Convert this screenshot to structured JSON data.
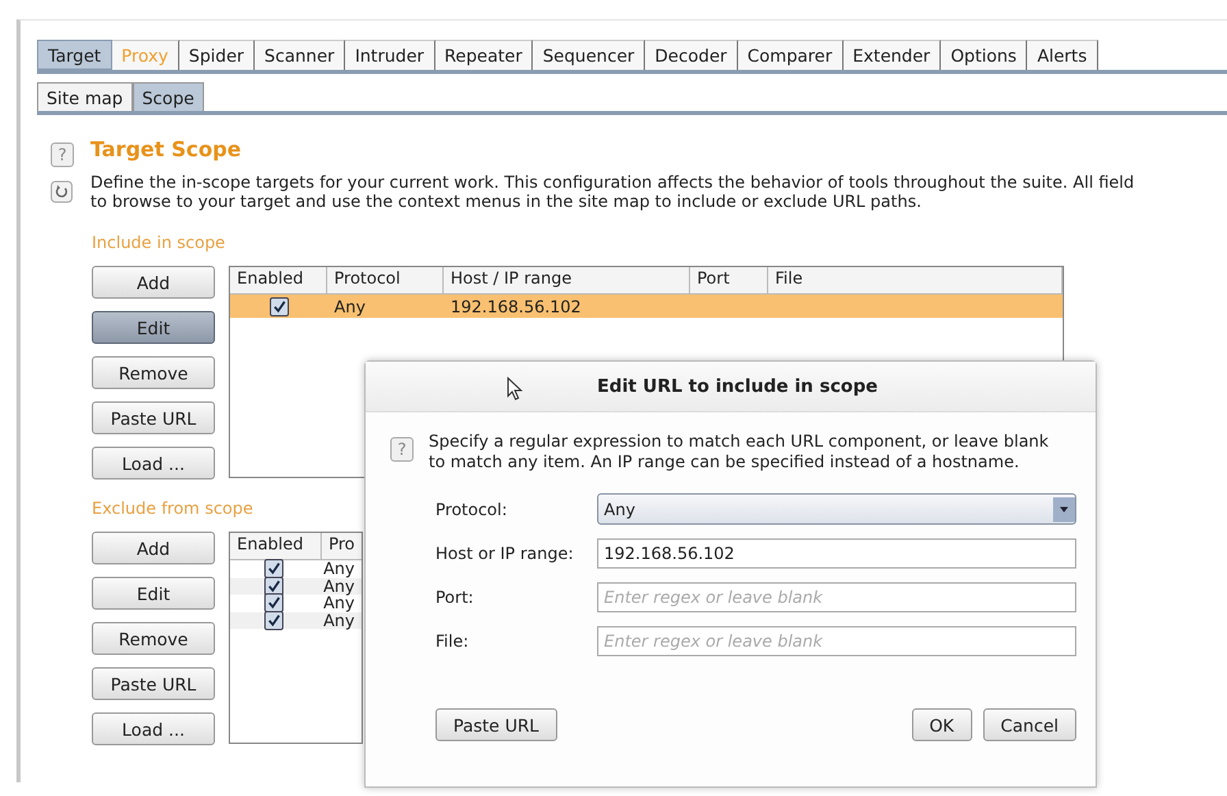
{
  "tabs": [
    {
      "label": "Target",
      "selected": true,
      "attention": false
    },
    {
      "label": "Proxy",
      "selected": false,
      "attention": true
    },
    {
      "label": "Spider",
      "selected": false,
      "attention": false
    },
    {
      "label": "Scanner",
      "selected": false,
      "attention": false
    },
    {
      "label": "Intruder",
      "selected": false,
      "attention": false
    },
    {
      "label": "Repeater",
      "selected": false,
      "attention": false
    },
    {
      "label": "Sequencer",
      "selected": false,
      "attention": false
    },
    {
      "label": "Decoder",
      "selected": false,
      "attention": false
    },
    {
      "label": "Comparer",
      "selected": false,
      "attention": false
    },
    {
      "label": "Extender",
      "selected": false,
      "attention": false
    },
    {
      "label": "Options",
      "selected": false,
      "attention": false
    },
    {
      "label": "Alerts",
      "selected": false,
      "attention": false
    }
  ],
  "subtabs": [
    {
      "label": "Site map",
      "selected": false
    },
    {
      "label": "Scope",
      "selected": true
    }
  ],
  "help_icon": "?",
  "title": "Target Scope",
  "description": "Define the in-scope targets for your current work. This configuration affects the behavior of tools throughout the suite. All field\nto browse to your target and use the context menus in the site map to include or exclude URL paths.",
  "include": {
    "label": "Include in scope",
    "buttons": [
      {
        "label": "Add",
        "pressed": false
      },
      {
        "label": "Edit",
        "pressed": true
      },
      {
        "label": "Remove",
        "pressed": false
      },
      {
        "label": "Paste URL",
        "pressed": false
      },
      {
        "label": "Load ...",
        "pressed": false
      }
    ],
    "columns": [
      "Enabled",
      "Protocol",
      "Host / IP range",
      "Port",
      "File"
    ],
    "rows": [
      {
        "enabled": true,
        "selected": true,
        "cells": [
          "",
          "Any",
          "192.168.56.102"
        ]
      }
    ]
  },
  "exclude": {
    "label": "Exclude from scope",
    "buttons": [
      {
        "label": "Add",
        "pressed": false
      },
      {
        "label": "Edit",
        "pressed": false
      },
      {
        "label": "Remove",
        "pressed": false
      },
      {
        "label": "Paste URL",
        "pressed": false
      },
      {
        "label": "Load ...",
        "pressed": false
      }
    ],
    "columns": [
      "Enabled",
      "Pro"
    ],
    "rows": [
      {
        "enabled": true,
        "selected": false,
        "cells": [
          "",
          "Any"
        ]
      },
      {
        "enabled": true,
        "selected": false,
        "cells": [
          "",
          "Any"
        ]
      },
      {
        "enabled": true,
        "selected": false,
        "cells": [
          "",
          "Any"
        ]
      },
      {
        "enabled": true,
        "selected": false,
        "cells": [
          "",
          "Any"
        ]
      }
    ]
  },
  "dialog": {
    "title": "Edit URL to include in scope",
    "help_icon": "?",
    "message": "Specify a regular expression to match each URL component, or leave blank to match any item. An IP range can be specified instead of a hostname.",
    "fields": [
      {
        "kind": "select",
        "label": "Protocol:",
        "value": "Any"
      },
      {
        "kind": "text",
        "label": "Host or IP range:",
        "value": "192.168.56.102"
      },
      {
        "kind": "text",
        "label": "Port:",
        "placeholder": "Enter regex or leave blank"
      },
      {
        "kind": "text",
        "label": "File:",
        "placeholder": "Enter regex or leave blank"
      }
    ],
    "left_button": "Paste URL",
    "buttons": [
      "OK",
      "Cancel"
    ]
  }
}
